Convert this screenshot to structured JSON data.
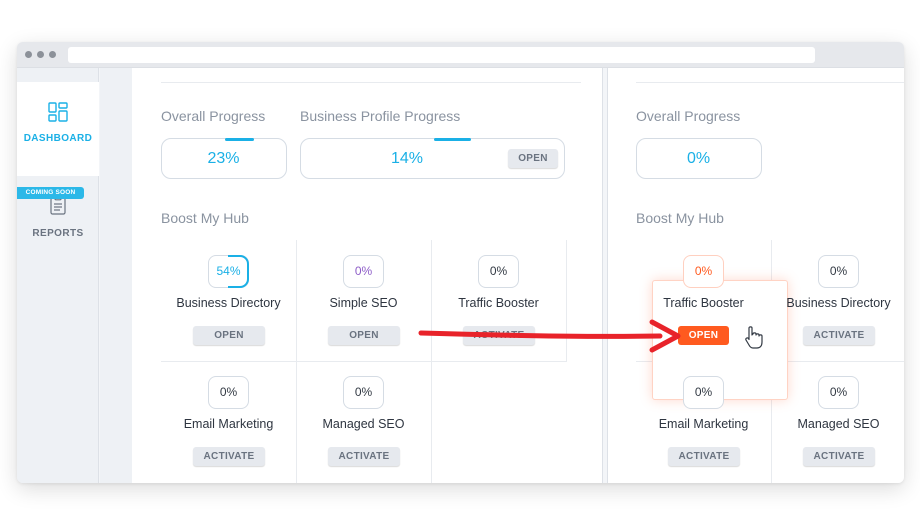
{
  "colors": {
    "accent": "#1ab0e6",
    "highlight_orange": "#ff5a1f",
    "arrow_red": "#e8232a",
    "muted_text": "#8a93a0"
  },
  "sidebar": {
    "items": [
      {
        "label": "DASHBOARD",
        "icon": "dashboard-icon",
        "active": true
      },
      {
        "label": "REPORTS",
        "icon": "reports-icon",
        "badge": "COMING SOON"
      }
    ]
  },
  "left_panel": {
    "overall_progress": {
      "label": "Overall Progress",
      "value": "23%",
      "fill_fraction": 0.23
    },
    "business_profile_progress": {
      "label": "Business Profile Progress",
      "value": "14%",
      "fill_fraction": 0.14,
      "button": "OPEN"
    },
    "boost_title": "Boost My Hub",
    "cards": [
      {
        "name": "Business Directory",
        "percent": "54%",
        "fill_fraction": 0.54,
        "button": "OPEN"
      },
      {
        "name": "Simple SEO",
        "percent": "0%",
        "button": "OPEN"
      },
      {
        "name": "Traffic Booster",
        "percent": "0%",
        "button": "ACTIVATE"
      },
      {
        "name": "Email Marketing",
        "percent": "0%",
        "button": "ACTIVATE"
      },
      {
        "name": "Managed SEO",
        "percent": "0%",
        "button": "ACTIVATE"
      }
    ]
  },
  "right_panel": {
    "overall_progress": {
      "label": "Overall Progress",
      "value": "0%"
    },
    "boost_title": "Boost My Hub",
    "cards": [
      {
        "name": "Traffic Booster",
        "percent": "0%",
        "button": "OPEN",
        "highlighted": true
      },
      {
        "name": "Business Directory",
        "percent": "0%",
        "button": "ACTIVATE"
      },
      {
        "name": "Email Marketing",
        "percent": "0%",
        "button": "ACTIVATE"
      },
      {
        "name": "Managed SEO",
        "percent": "0%",
        "button": "ACTIVATE"
      }
    ]
  },
  "cursor": "hand-pointer-icon"
}
